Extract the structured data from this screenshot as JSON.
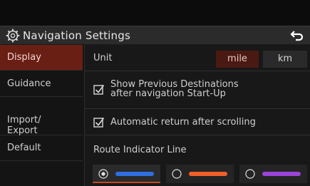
{
  "header": {
    "title": "Navigation Settings",
    "icon": "gear-icon",
    "back_icon": "back-arrow-icon"
  },
  "sidebar": {
    "items": [
      {
        "label": "Display",
        "active": true
      },
      {
        "label": "Guidance",
        "active": false
      },
      {
        "label": "Import/\nExport",
        "active": false
      },
      {
        "label": "Default",
        "active": false
      }
    ]
  },
  "unit": {
    "label": "Unit",
    "options": [
      "mile",
      "km"
    ],
    "selected": "mile"
  },
  "options": {
    "show_previous": {
      "label": "Show Previous Destinations\nafter navigation Start-Up",
      "checked": true
    },
    "auto_return": {
      "label": "Automatic return after scrolling",
      "checked": true
    }
  },
  "route_line": {
    "label": "Route Indicator Line",
    "colors": [
      {
        "name": "blue",
        "hex": "#2f6fe0",
        "selected": true
      },
      {
        "name": "orange",
        "hex": "#f0602a",
        "selected": false
      },
      {
        "name": "purple",
        "hex": "#9a44d8",
        "selected": false
      }
    ]
  },
  "colors": {
    "accent": "#6a1f14",
    "accent_underline": "#c44a1f"
  }
}
